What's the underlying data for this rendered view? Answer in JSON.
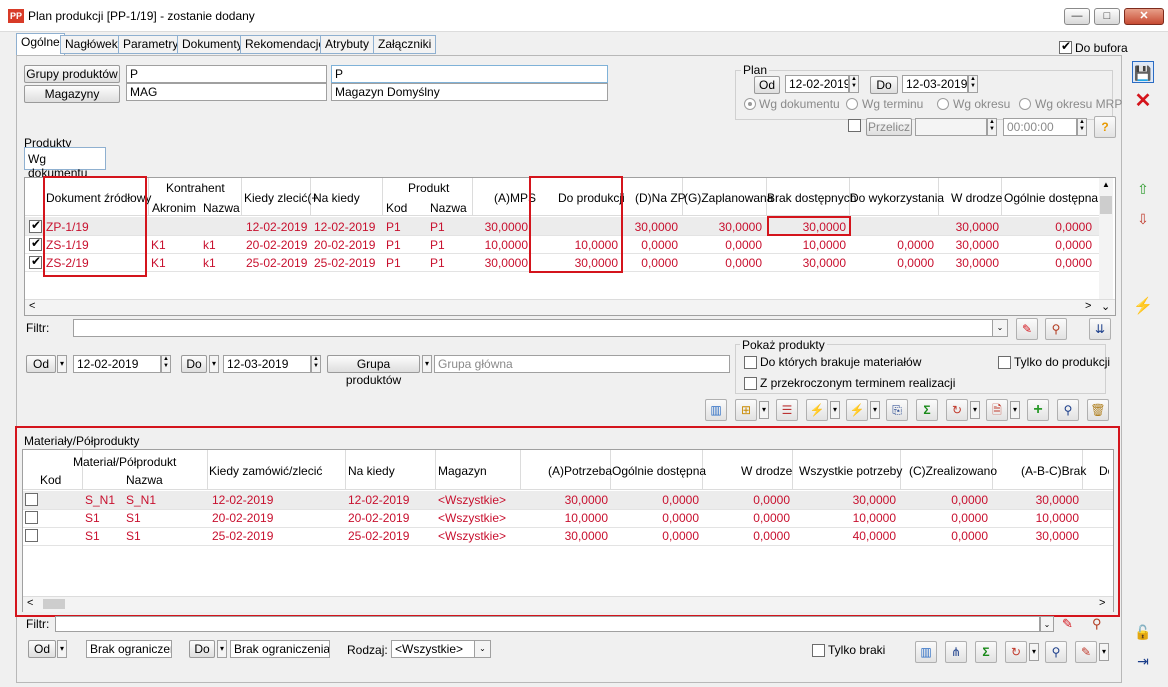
{
  "window": {
    "title": "Plan produkcji [PP-1/19] - zostanie dodany",
    "app_icon": "PP"
  },
  "tabs": [
    "Ogólne",
    "Nagłówek",
    "Parametry",
    "Dokumenty",
    "Rekomendacje",
    "Atrybuty",
    "Załączniki"
  ],
  "do_bufora": "Do bufora",
  "grupy": {
    "label": "Grupy produktów",
    "code": "P",
    "name": "P"
  },
  "magazyny": {
    "label": "Magazyny",
    "code": "MAG",
    "name": "Magazyn Domyślny"
  },
  "plan": {
    "legend": "Plan",
    "od_label": "Od",
    "od_value": "12-02-2019",
    "do_label": "Do",
    "do_value": "12-03-2019",
    "radios": [
      "Wg dokumentu",
      "Wg terminu",
      "Wg okresu",
      "Wg okresu MRP"
    ],
    "przelicz": "Przelicz",
    "time": "00:00:00"
  },
  "produkty": {
    "legend": "Produkty",
    "subtab": "Wg dokumentu",
    "group_headers": {
      "kontrahent": "Kontrahent",
      "produkt": "Produkt"
    },
    "headers": {
      "dokument": "Dokument źródłowy",
      "akronim": "Akronim",
      "nazwa": "Nazwa",
      "kiedy": "Kiedy zlecić(+",
      "na_kiedy": "Na kiedy",
      "kod": "Kod",
      "pnazwa": "Nazwa",
      "mps": "(A)MPS",
      "do_prod": "Do produkcji",
      "na_zp": "(D)Na ZP",
      "zaplanowana": "(G)Zaplanowana",
      "brak": "Brak dostępnych",
      "do_wyk": "Do wykorzystania",
      "w_drodze": "W drodze",
      "ogolnie": "Ogólnie dostępna"
    },
    "rows": [
      {
        "doc": "ZP-1/19",
        "akronim": "",
        "nazwa": "",
        "kiedy": "12-02-2019",
        "na_kiedy": "12-02-2019",
        "kod": "P1",
        "pnazwa": "P1",
        "mps": "30,0000",
        "do_prod": "",
        "na_zp": "30,0000",
        "zapl": "30,0000",
        "brak": "30,0000",
        "do_wyk": "",
        "w_drodze": "30,0000",
        "ogolnie": "0,0000"
      },
      {
        "doc": "ZS-1/19",
        "akronim": "K1",
        "nazwa": "k1",
        "kiedy": "20-02-2019",
        "na_kiedy": "20-02-2019",
        "kod": "P1",
        "pnazwa": "P1",
        "mps": "10,0000",
        "do_prod": "10,0000",
        "na_zp": "0,0000",
        "zapl": "0,0000",
        "brak": "10,0000",
        "do_wyk": "0,0000",
        "w_drodze": "30,0000",
        "ogolnie": "0,0000"
      },
      {
        "doc": "ZS-2/19",
        "akronim": "K1",
        "nazwa": "k1",
        "kiedy": "25-02-2019",
        "na_kiedy": "25-02-2019",
        "kod": "P1",
        "pnazwa": "P1",
        "mps": "30,0000",
        "do_prod": "30,0000",
        "na_zp": "0,0000",
        "zapl": "0,0000",
        "brak": "30,0000",
        "do_wyk": "0,0000",
        "w_drodze": "30,0000",
        "ogolnie": "0,0000"
      }
    ]
  },
  "filter1": {
    "label": "Filtr:"
  },
  "range1": {
    "od": "Od",
    "od_value": "12-02-2019",
    "do": "Do",
    "do_value": "12-03-2019",
    "grupa_btn": "Grupa produktów",
    "grupa_value": "Grupa główna"
  },
  "pokaz": {
    "legend": "Pokaż produkty",
    "opt1": "Do których brakuje materiałów",
    "opt2": "Tylko do produkcji",
    "opt3": "Z przekroczonym terminem realizacji"
  },
  "materialy": {
    "legend": "Materiały/Półprodukty",
    "group_header": "Materiał/Półprodukt",
    "headers": {
      "kod": "Kod",
      "nazwa": "Nazwa",
      "kiedy": "Kiedy zamówić/zlecić",
      "na_kiedy": "Na kiedy",
      "magazyn": "Magazyn",
      "potrzeba": "(A)Potrzeba",
      "ogolnie": "Ogólnie dostępna",
      "w_drodze": "W drodze",
      "wszystkie": "Wszystkie potrzeby",
      "zreal": "(C)Zrealizowano",
      "brak": "(A-B-C)Brak",
      "d": "Do"
    },
    "rows": [
      {
        "kod": "S_N1",
        "nazwa": "S_N1",
        "kiedy": "12-02-2019",
        "na_kiedy": "12-02-2019",
        "magazyn": "<Wszystkie>",
        "potrzeba": "30,0000",
        "ogolnie": "0,0000",
        "w_drodze": "0,0000",
        "wszystkie": "30,0000",
        "zreal": "0,0000",
        "brak": "30,0000"
      },
      {
        "kod": "S1",
        "nazwa": "S1",
        "kiedy": "20-02-2019",
        "na_kiedy": "20-02-2019",
        "magazyn": "<Wszystkie>",
        "potrzeba": "10,0000",
        "ogolnie": "0,0000",
        "w_drodze": "0,0000",
        "wszystkie": "10,0000",
        "zreal": "0,0000",
        "brak": "10,0000"
      },
      {
        "kod": "S1",
        "nazwa": "S1",
        "kiedy": "25-02-2019",
        "na_kiedy": "25-02-2019",
        "magazyn": "<Wszystkie>",
        "potrzeba": "30,0000",
        "ogolnie": "0,0000",
        "w_drodze": "0,0000",
        "wszystkie": "40,0000",
        "zreal": "0,0000",
        "brak": "30,0000"
      }
    ]
  },
  "filter2": {
    "label": "Filtr:"
  },
  "range2": {
    "od": "Od",
    "od_value": "Brak ograniczenia",
    "do": "Do",
    "do_value": "Brak ograniczenia",
    "rodzaj_label": "Rodzaj:",
    "rodzaj_value": "<Wszystkie>",
    "tylko_braki": "Tylko braki"
  },
  "colors": {
    "accent_red": "#d4141c",
    "data_red": "#c8102e",
    "tab_border": "#8fb0d0"
  }
}
